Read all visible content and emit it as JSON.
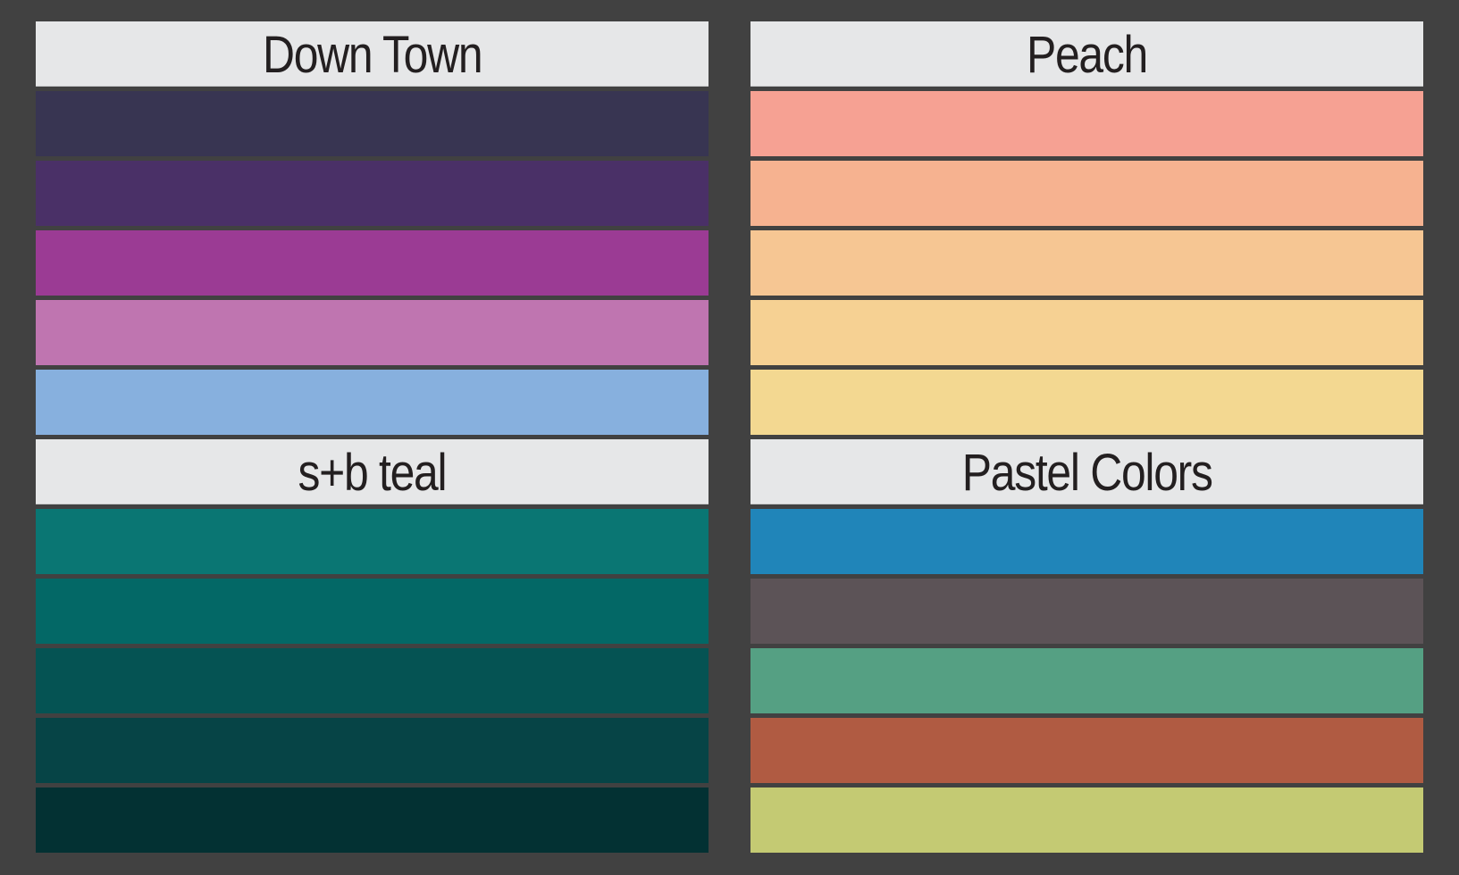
{
  "palettes": [
    {
      "title": "Down Town",
      "swatches": [
        "#383552",
        "#4a3067",
        "#9b3b94",
        "#bf75b0",
        "#87b0de"
      ]
    },
    {
      "title": "Peach",
      "swatches": [
        "#f6a193",
        "#f6b290",
        "#f6c693",
        "#f6d193",
        "#f3d891"
      ]
    },
    {
      "title": "s+b teal",
      "swatches": [
        "#0a7673",
        "#036866",
        "#055353",
        "#064446",
        "#033133"
      ]
    },
    {
      "title": "Pastel Colors",
      "swatches": [
        "#2085b9",
        "#5c5357",
        "#55a083",
        "#b05b42",
        "#c4ca73"
      ]
    }
  ]
}
